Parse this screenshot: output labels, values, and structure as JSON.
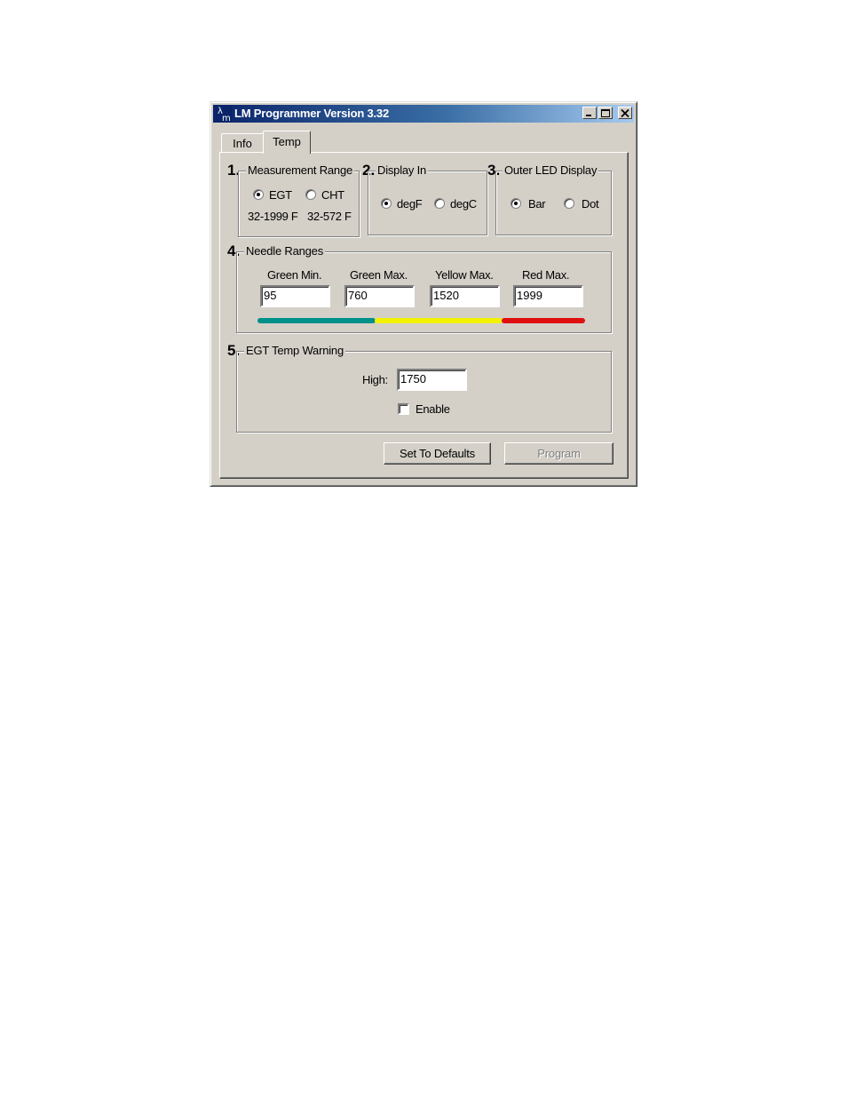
{
  "window": {
    "title": "LM Programmer Version 3.32"
  },
  "tabs": [
    {
      "label": "Info"
    },
    {
      "label": "Temp"
    }
  ],
  "measurement_range": {
    "number": "1.",
    "legend": "Measurement Range",
    "options": [
      {
        "label": "EGT",
        "selected": true
      },
      {
        "label": "CHT",
        "selected": false
      }
    ],
    "ranges": [
      "32-1999 F",
      "32-572 F"
    ]
  },
  "display_in": {
    "number": "2.",
    "legend": "Display In",
    "options": [
      {
        "label": "degF",
        "selected": true
      },
      {
        "label": "degC",
        "selected": false
      }
    ]
  },
  "outer_led": {
    "number": "3.",
    "legend": "Outer LED Display",
    "options": [
      {
        "label": "Bar",
        "selected": true
      },
      {
        "label": "Dot",
        "selected": false
      }
    ]
  },
  "needle_ranges": {
    "number": "4.",
    "legend": "Needle Ranges",
    "fields": [
      {
        "label": "Green Min.",
        "value": "95"
      },
      {
        "label": "Green Max.",
        "value": "760"
      },
      {
        "label": "Yellow Max.",
        "value": "1520"
      },
      {
        "label": "Red Max.",
        "value": "1999"
      }
    ],
    "colors": {
      "green": "#00908a",
      "yellow": "#f2f200",
      "red": "#e01010"
    }
  },
  "egt_warning": {
    "number": "5.",
    "legend": "EGT Temp Warning",
    "high_label": "High:",
    "high_value": "1750",
    "enable_label": "Enable",
    "enable_checked": false
  },
  "buttons": {
    "defaults": "Set To Defaults",
    "program": "Program"
  }
}
